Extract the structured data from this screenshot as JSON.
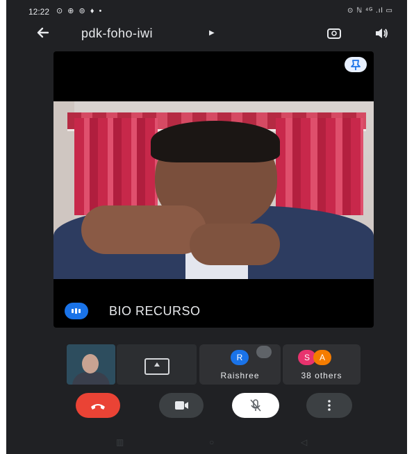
{
  "status_bar": {
    "time": "12:22",
    "left_icons": "⊙ ⊕ ⊚ ♦ •",
    "right_icons": "⊙ ℕ ⁴ᴳ .ıl ▭"
  },
  "header": {
    "meeting_code": "pdk-foho-iwi",
    "icons": [
      "back-arrow-icon",
      "camera-switch-icon",
      "speaker-icon"
    ]
  },
  "main_tile": {
    "speaker_name": "BIO RECURSO",
    "icons": [
      "pin-icon",
      "audio-level-icon"
    ]
  },
  "participants": {
    "tiles": [
      {
        "type": "self-video"
      },
      {
        "type": "screen-share",
        "icon": "present-screen-icon"
      },
      {
        "type": "avatar",
        "initial": "R",
        "name": "Raishree",
        "avatar_color": "#1a73e8",
        "muted": true
      },
      {
        "type": "group",
        "initials": [
          "S",
          "A"
        ],
        "label": "38 others",
        "avatar_colors": [
          "#e8336e",
          "#f57c00"
        ]
      }
    ]
  },
  "controls": {
    "buttons": [
      "end-call-icon",
      "camera-icon",
      "mic-off-icon",
      "more-options-icon"
    ],
    "colors": {
      "end_call": "#ea4335",
      "button_dark": "#3c4043",
      "mic_bg": "#ffffff"
    }
  },
  "nav_bar": {
    "recents": "▥",
    "home": "○",
    "back": "◁"
  },
  "colors": {
    "background": "#202124",
    "accent": "#1a73e8",
    "text": "#e8eaed"
  }
}
